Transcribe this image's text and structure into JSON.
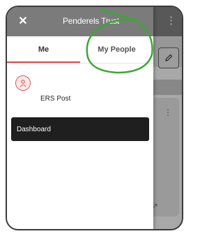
{
  "header": {
    "brand": "Penderels Trust",
    "close_icon": "close-icon",
    "menu_icon": "kebab-menu-icon"
  },
  "tabs": [
    {
      "label": "Me",
      "active": true
    },
    {
      "label": "My People",
      "active": false
    }
  ],
  "user": {
    "name": "ERS Post",
    "avatar_icon": "person-icon"
  },
  "nav": {
    "items": [
      {
        "label": "Dashboard",
        "selected": true
      }
    ]
  },
  "background": {
    "edit_icon": "pencil-icon",
    "card_menu_icon": "kebab-menu-icon",
    "arrow_icon": "arrow-icon"
  },
  "colors": {
    "header": "#7b7b7b",
    "accent": "#e04848",
    "selected_item": "#1f1f1f",
    "annotation": "#3aa832"
  }
}
